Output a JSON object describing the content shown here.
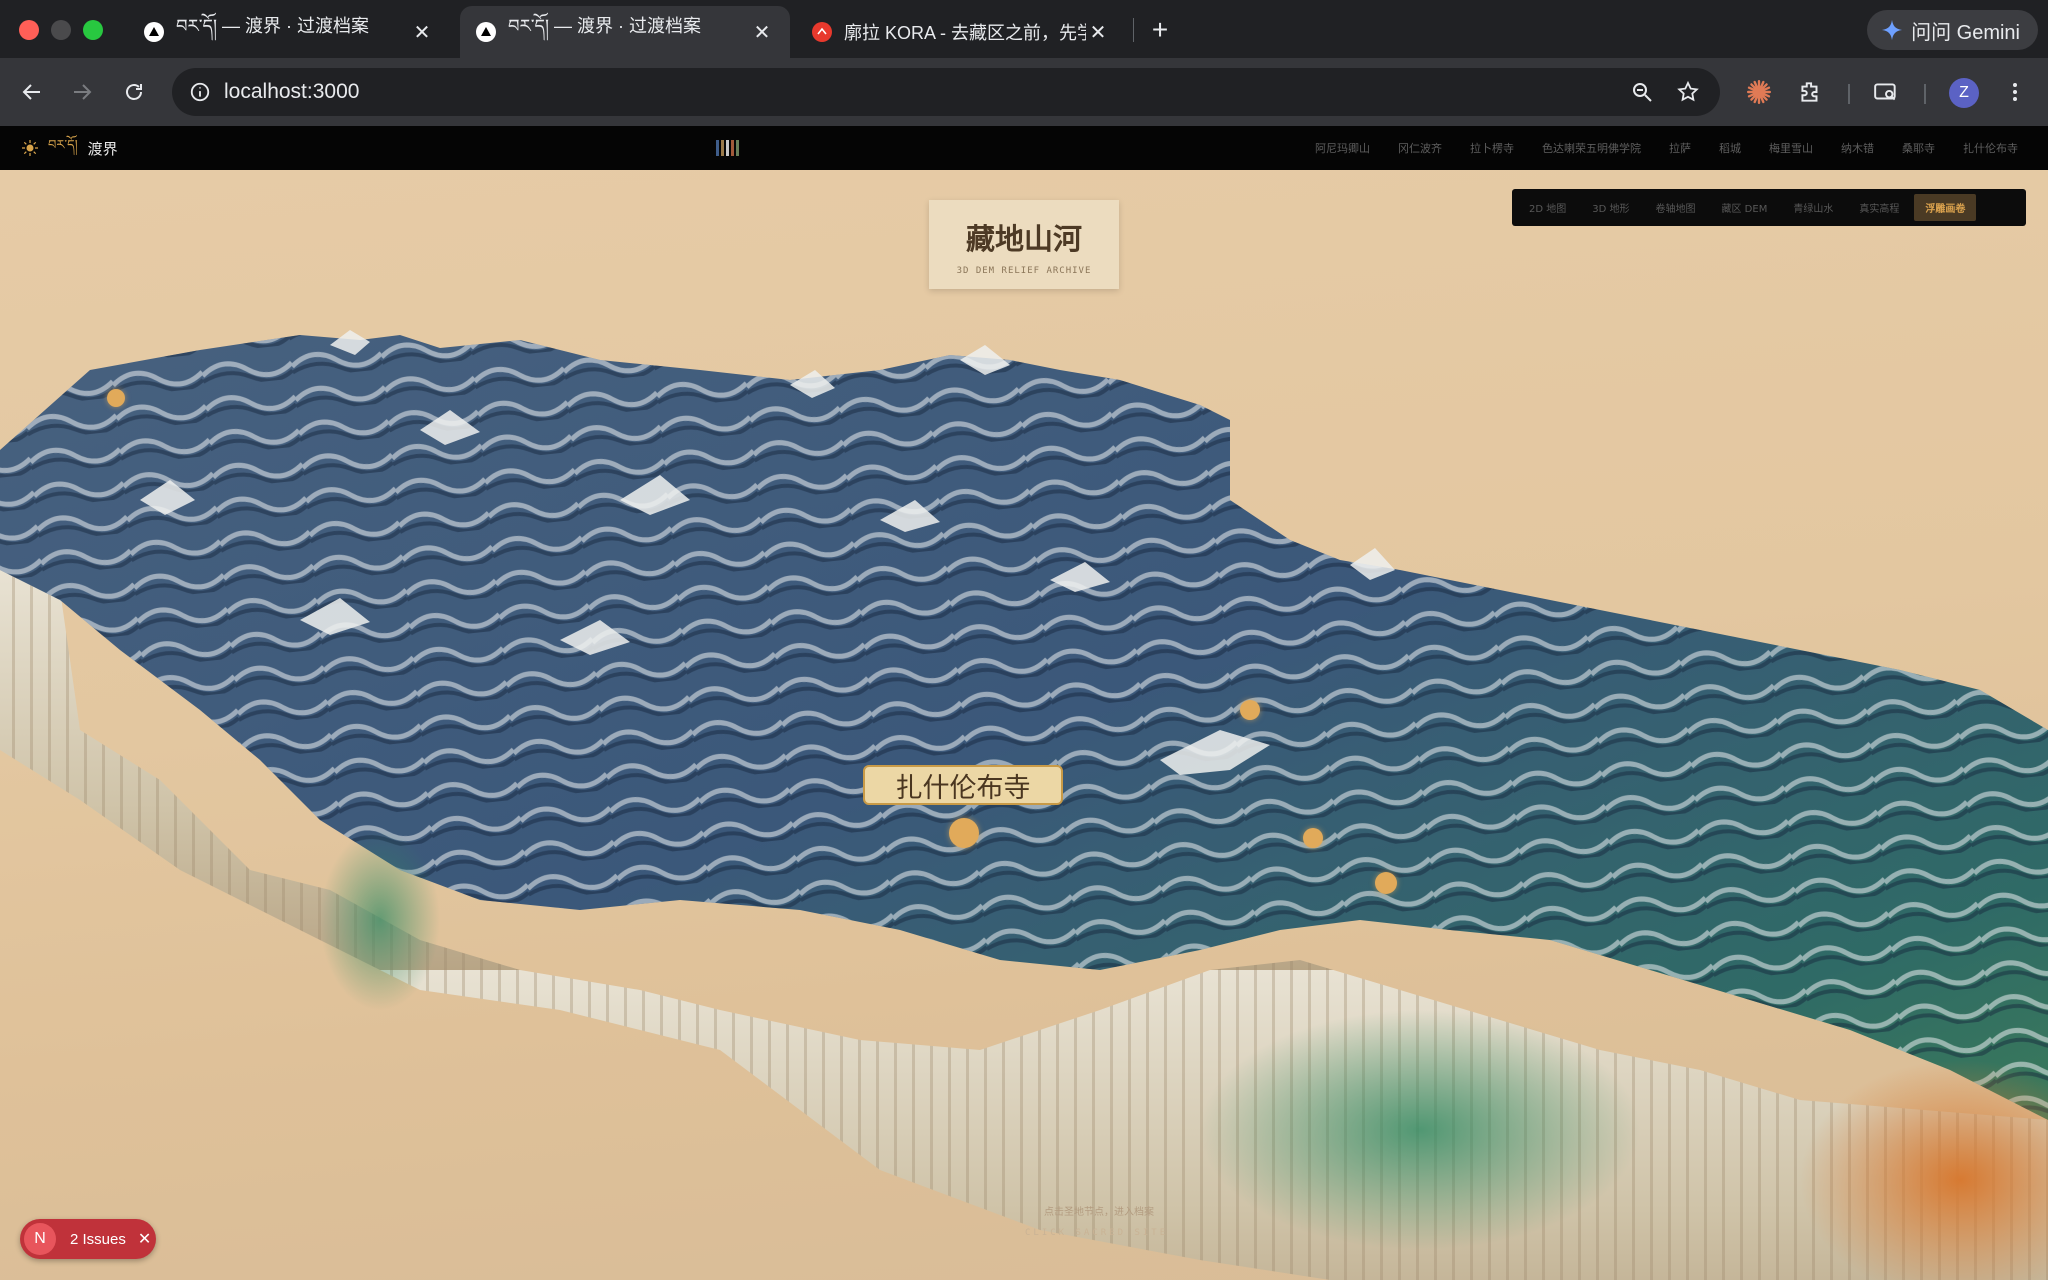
{
  "browser": {
    "tabs": [
      {
        "title": "བར་དོ། — 渡界 · 过渡档案",
        "active": false
      },
      {
        "title": "བར་དོ། — 渡界 · 过渡档案",
        "active": true
      },
      {
        "title": "廓拉 KORA - 去藏区之前，先学",
        "active": false
      }
    ],
    "gemini_label": "问问 Gemini",
    "url": "localhost:3000",
    "profile_initial": "Z"
  },
  "site": {
    "brand_tibetan": "བར་དོ།",
    "brand_name": "渡界",
    "nav": [
      "阿尼玛卿山",
      "冈仁波齐",
      "拉卜楞寺",
      "色达喇荣五明佛学院",
      "拉萨",
      "稻城",
      "梅里雪山",
      "纳木错",
      "桑耶寺",
      "扎什伦布寺"
    ]
  },
  "title_card": {
    "title": "藏地山河",
    "subtitle": "3D DEM RELIEF ARCHIVE"
  },
  "view_switch": {
    "options": [
      "2D 地图",
      "3D 地形",
      "卷轴地图",
      "藏区 DEM",
      "青绿山水",
      "真实高程",
      "浮雕画卷"
    ],
    "active": "浮雕画卷"
  },
  "map": {
    "selected_place": "扎什伦布寺",
    "hint": "点击圣地节点，进入档案",
    "hint_sub": "CLICK SACRED SITE"
  },
  "dev_overlay": {
    "badge": "N",
    "issues_label": "2 Issues"
  },
  "colors": {
    "accent": "#d8a04d",
    "paper": "#e6cba5",
    "terrain_blue": "#3e5b7d",
    "snow": "#e8e7e1"
  }
}
